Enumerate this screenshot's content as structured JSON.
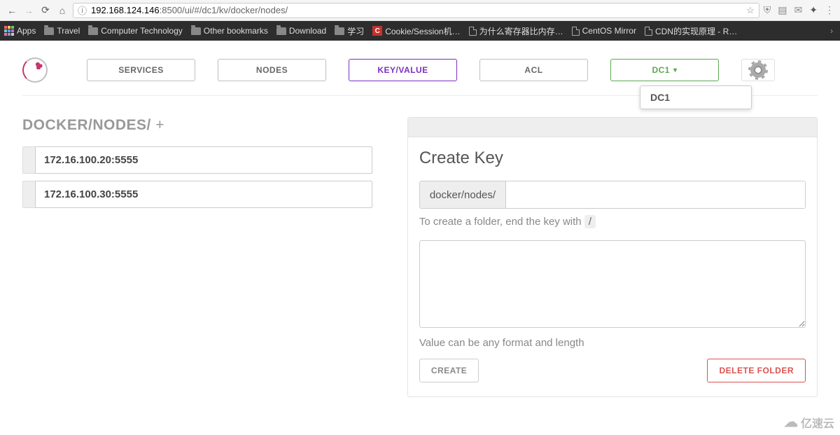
{
  "browser": {
    "url_host": "192.168.124.146",
    "url_rest": ":8500/ui/#/dc1/kv/docker/nodes/"
  },
  "bookmarks": {
    "apps": "Apps",
    "items": [
      "Travel",
      "Computer Technology",
      "Other bookmarks",
      "Download",
      "学习",
      "Cookie/Session机…",
      "为什么寄存器比内存…",
      "CentOS Mirror",
      "CDN的实现原理 - R…"
    ]
  },
  "nav": {
    "services": "SERVICES",
    "nodes": "NODES",
    "kv": "KEY/VALUE",
    "acl": "ACL",
    "dc": "DC1",
    "dropdown_item": "DC1"
  },
  "breadcrumb": {
    "path": "DOCKER/NODES/",
    "plus": "+"
  },
  "kv_list": [
    "172.16.100.20:5555",
    "172.16.100.30:5555"
  ],
  "panel": {
    "title": "Create Key",
    "prefix": "docker/nodes/",
    "key_value": "",
    "helper_pre": "To create a folder, end the key with ",
    "helper_kbd": "/",
    "value": "",
    "helper2": "Value can be any format and length",
    "create": "CREATE",
    "delete": "DELETE FOLDER"
  },
  "watermark": "亿速云"
}
